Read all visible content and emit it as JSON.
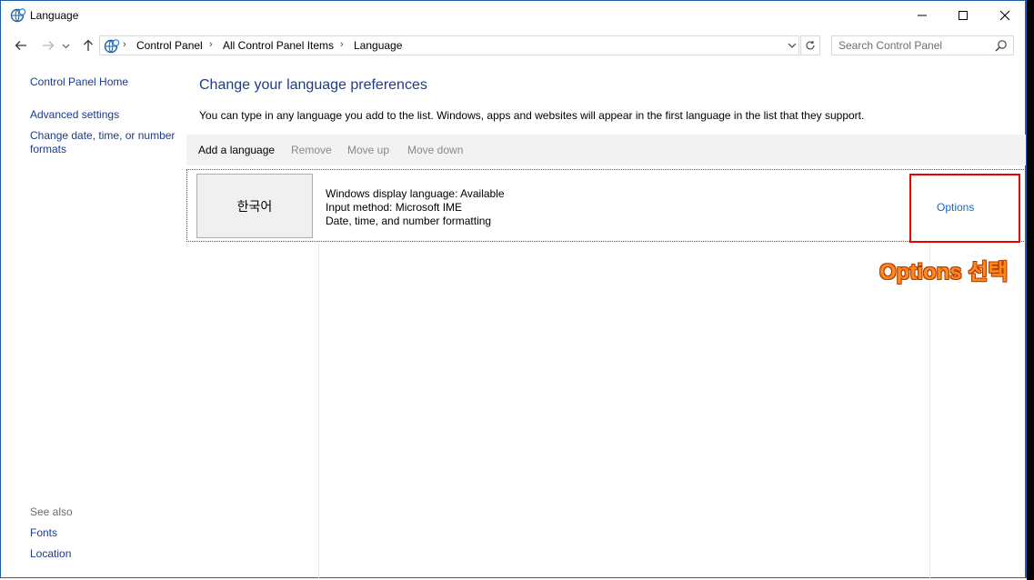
{
  "window": {
    "title": "Language",
    "icon": "globe-clock-icon"
  },
  "address_bar": {
    "breadcrumbs": [
      "Control Panel",
      "All Control Panel Items",
      "Language"
    ],
    "search_placeholder": "Search Control Panel"
  },
  "sidebar": {
    "items": [
      {
        "label": "Control Panel Home"
      },
      {
        "label": "Advanced settings"
      },
      {
        "label": "Change date, time, or number formats"
      }
    ],
    "see_also_label": "See also",
    "see_also_items": [
      {
        "label": "Fonts"
      },
      {
        "label": "Location"
      }
    ]
  },
  "main": {
    "heading": "Change your language preferences",
    "description": "You can type in any language you add to the list. Windows, apps and websites will appear in the first language in the list that they support.",
    "toolbar": {
      "add_language": "Add a language",
      "remove": "Remove",
      "move_up": "Move up",
      "move_down": "Move down"
    },
    "languages": [
      {
        "name": "한국어",
        "display_language": "Windows display language: Available",
        "input_method": "Input method: Microsoft IME",
        "formatting": "Date, time, and number formatting",
        "options_label": "Options"
      }
    ]
  },
  "annotation": {
    "text": "Options 선택",
    "highlight_color": "#ee0000",
    "text_color": "#ff8a1c"
  }
}
